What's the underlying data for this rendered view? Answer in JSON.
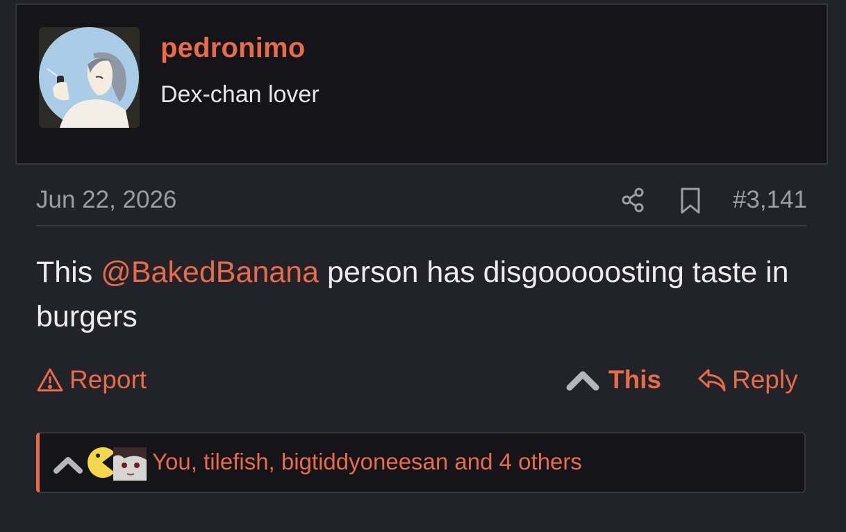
{
  "author": {
    "username": "pedronimo",
    "title": "Dex-chan lover"
  },
  "post": {
    "date": "Jun 22, 2026",
    "number": "#3,141",
    "message": {
      "before": "This ",
      "mention": "@BakedBanana",
      "after": " person has disgooooosting taste in burgers"
    }
  },
  "actions": {
    "report_label": "Report",
    "this_label": "This",
    "reply_label": "Reply"
  },
  "reactions": {
    "summary": "You, tilefish, bigtiddyoneesan and 4 others"
  },
  "icons": [
    "share-icon",
    "bookmark-icon",
    "warning-icon",
    "upvote-icon",
    "reply-icon",
    "pacman-icon"
  ],
  "colors": {
    "accent": "#e86b4a",
    "background": "#222329",
    "card": "#141419",
    "text": "#ececef",
    "muted": "#9c9ea5"
  }
}
